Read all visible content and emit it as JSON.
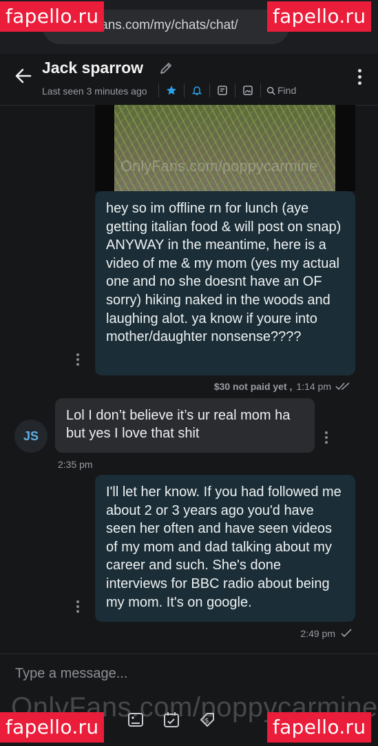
{
  "browser": {
    "url": "onlyfans.com/my/chats/chat/"
  },
  "watermarks": {
    "site_badge": "fapello.ru",
    "media_overlay": "OnlyFans.com/poppycarmine",
    "bottom_overlay": "OnlyFans.com/poppycarmine"
  },
  "chat_header": {
    "name": "Jack sparrow",
    "last_seen": "Last seen 3 minutes ago",
    "find_label": "Find",
    "icons": [
      "star-icon",
      "bell-icon",
      "note-icon",
      "image-icon",
      "search-icon"
    ]
  },
  "messages": [
    {
      "direction": "out",
      "text": "hey so im offline rn for lunch (aye getting italian food & will post on snap) ANYWAY in the meantime, here is a video of me & my mom (yes my actual one and no she doesnt have an OF sorry) hiking naked in the woods and laughing alot. ya know if youre into mother/daughter nonsense????",
      "price": "$30 not paid yet ,",
      "time": "1:14 pm"
    },
    {
      "direction": "in",
      "avatar_initials": "JS",
      "text": "Lol I don’t believe it’s ur real mom ha but yes I love that shit",
      "time": "2:35 pm"
    },
    {
      "direction": "out",
      "text": "I'll let her know. If you had followed me about 2 or 3 years ago you'd have seen her often and have seen videos of my mom and dad talking about my career and such. She's done interviews for BBC radio about being my mom. It's on google.",
      "time": "2:49 pm"
    }
  ],
  "composer": {
    "placeholder": "Type a message..."
  },
  "colors": {
    "accent": "#2aa1e8",
    "badge": "#ea1d3a",
    "bubble_out": "#1b2d36",
    "bubble_in": "#2a2c30"
  }
}
